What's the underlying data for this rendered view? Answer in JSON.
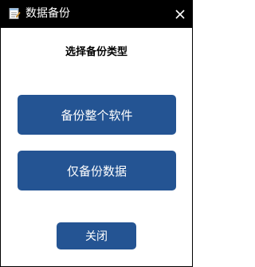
{
  "window": {
    "title": "数据备份",
    "icon": "notepad-icon",
    "close_icon": "close-icon"
  },
  "dialog": {
    "heading": "选择备份类型",
    "full_backup_label": "备份整个软件",
    "data_backup_label": "仅备份数据",
    "close_label": "关闭"
  },
  "colors": {
    "titlebar": "#000000",
    "button": "#245493",
    "button_text": "#ffffff"
  }
}
